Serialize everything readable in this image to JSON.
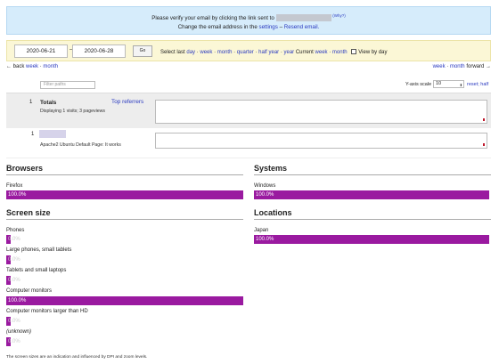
{
  "notice": {
    "line1": "Please verify your email by clicking the link sent to",
    "why": "(Why?)",
    "line2_pre": "Change the email address in the",
    "settings_link": "settings",
    "dash": " – ",
    "resend_link": "Resend email."
  },
  "range": {
    "start": "2020-06-21",
    "end": "2020-06-28",
    "dash": "–",
    "go": "Go",
    "select_last": "Select last",
    "last_day": "day",
    "last_week": "week",
    "last_month": "month",
    "last_quarter": "quarter",
    "last_half_year": "half year",
    "last_year": "year",
    "current": "Current",
    "current_week": "week",
    "current_month": "month",
    "view_by_day": "View by day",
    "sep": " · "
  },
  "nav": {
    "back_arrow": "←",
    "back": "back",
    "back_week": "week",
    "back_month": "month",
    "fwd_week": "week",
    "fwd_month": "month",
    "forward": "forward",
    "fwd_arrow": "→"
  },
  "filter": {
    "placeholder": "Filter paths"
  },
  "yscale": {
    "label": "Y-axis scale",
    "value": "10",
    "spin": "⬍",
    "reset": "reset; half"
  },
  "totals": {
    "count": "1",
    "title": "Totals",
    "sub": "Displaying 1 visits; 3 pageviews",
    "top_referrers": "Top referrers"
  },
  "page_row": {
    "count": "1",
    "sub": "Apache2 Ubuntu Default Page: It works"
  },
  "browsers": {
    "title": "Browsers",
    "items": [
      {
        "name": "Firefox",
        "pct": "100.0%",
        "value": 100
      }
    ]
  },
  "systems": {
    "title": "Systems",
    "items": [
      {
        "name": "Windows",
        "pct": "100.0%",
        "value": 100
      }
    ]
  },
  "screen": {
    "title": "Screen size",
    "items": [
      {
        "name": "Phones",
        "pct": "0.0%",
        "value": 0
      },
      {
        "name": "Large phones, small tablets",
        "pct": "0.0%",
        "value": 0
      },
      {
        "name": "Tablets and small laptops",
        "pct": "0.0%",
        "value": 0
      },
      {
        "name": "Computer monitors",
        "pct": "100.0%",
        "value": 100
      },
      {
        "name": "Computer monitors larger than HD",
        "pct": "0.0%",
        "value": 0
      },
      {
        "name": "(unknown)",
        "pct": "0.0%",
        "value": 0
      }
    ]
  },
  "locations": {
    "title": "Locations",
    "items": [
      {
        "name": "Japan",
        "pct": "100.0%",
        "value": 100
      }
    ]
  },
  "footer": "The screen sizes are an indication and influenced by DPI and zoom levels."
}
